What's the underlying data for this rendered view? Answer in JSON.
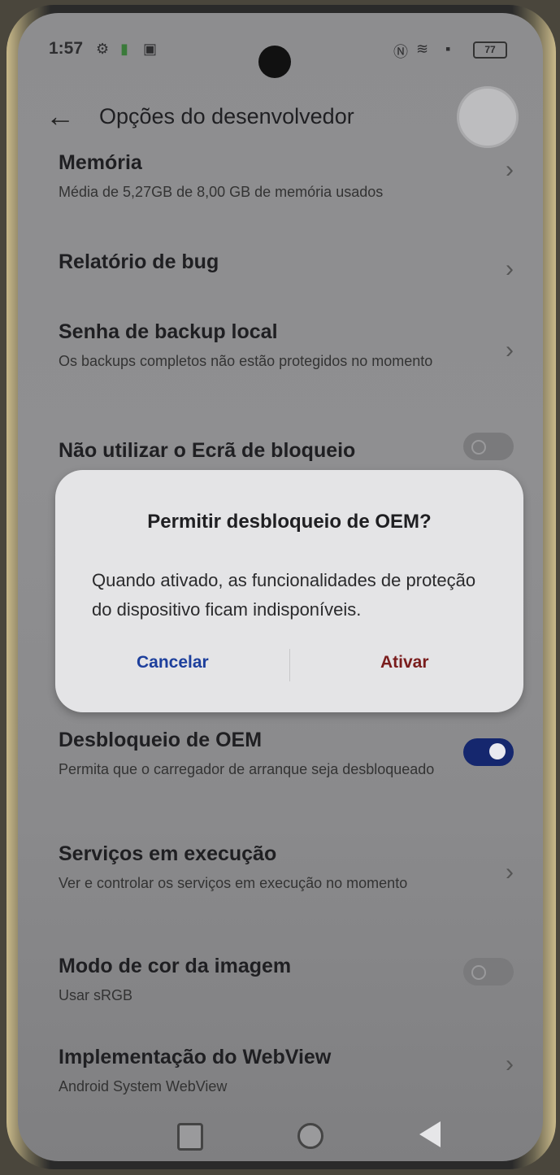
{
  "status_bar": {
    "time": "1:57",
    "battery": "77"
  },
  "header": {
    "back_icon": "←",
    "title": "Opções do desenvolvedor"
  },
  "settings": [
    {
      "title": "Memória",
      "subtitle": "Média de 5,27GB de 8,00 GB de memória usados"
    },
    {
      "title": "Relatório de bug",
      "subtitle": ""
    },
    {
      "title": "Senha de backup local",
      "subtitle": "Os backups completos não estão protegidos no momento"
    },
    {
      "title": "Não utilizar o Ecrã de bloqueio",
      "subtitle": ""
    },
    {
      "title": "Desbloqueio de OEM",
      "subtitle": "Permita que o carregador de arranque seja desbloqueado"
    },
    {
      "title": "Serviços em execução",
      "subtitle": "Ver e controlar os serviços em execução no momento"
    },
    {
      "title": "Modo de cor da imagem",
      "subtitle": "Usar sRGB"
    },
    {
      "title": "Implementação do WebView",
      "subtitle": "Android System WebView"
    }
  ],
  "toggles": {
    "lockscreen": false,
    "oem": true,
    "color_mode": false
  },
  "dialog": {
    "title": "Permitir desbloqueio de OEM?",
    "message": "Quando ativado, as funcionalidades de proteção do dispositivo ficam indisponíveis.",
    "cancel_label": "Cancelar",
    "confirm_label": "Ativar"
  },
  "colors": {
    "toggle_on": "#15276e",
    "cancel": "#1d3f9c",
    "confirm": "#7a1d1d"
  },
  "icons": {
    "chevron": "›"
  }
}
